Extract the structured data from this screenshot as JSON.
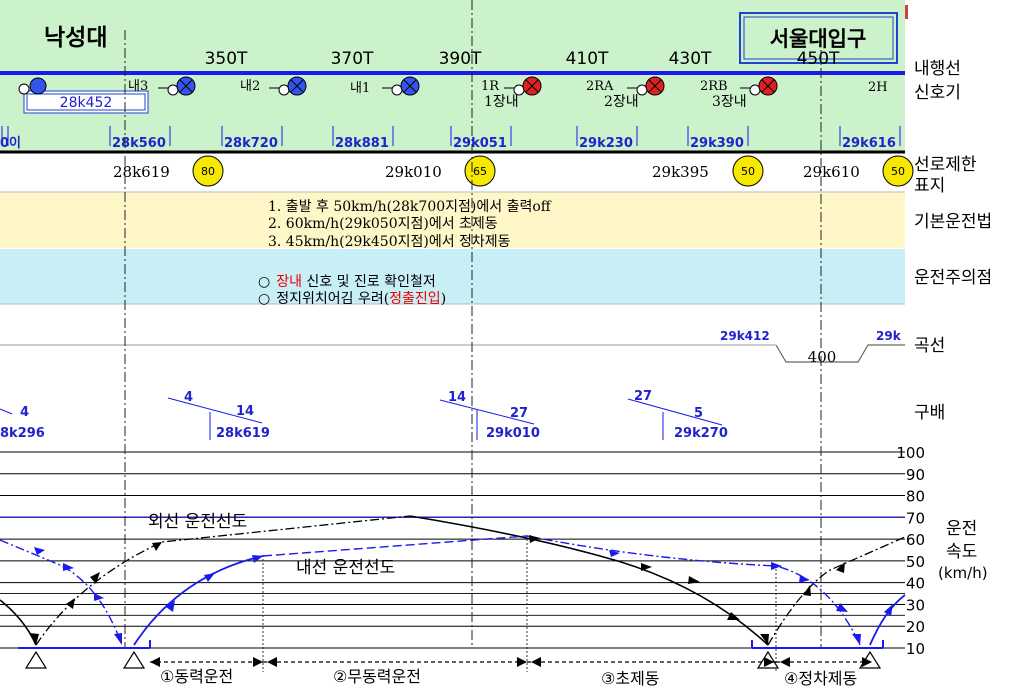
{
  "stations": {
    "left": "낙성대",
    "right": "서울대입구"
  },
  "track_circuits": [
    "350T",
    "370T",
    "390T",
    "410T",
    "430T",
    "450T"
  ],
  "signals": [
    {
      "label": "내3",
      "color": "#3355ee"
    },
    {
      "label": "내2",
      "color": "#3355ee"
    },
    {
      "label": "내1",
      "color": "#3355ee"
    },
    {
      "label": "1R",
      "sub": "1장내",
      "color": "#dd2222"
    },
    {
      "label": "2RA",
      "sub": "2장내",
      "color": "#dd2222"
    },
    {
      "label": "2RB",
      "sub": "3장내",
      "color": "#dd2222"
    },
    {
      "label": "2H"
    }
  ],
  "station_box_km": "28k452",
  "km_posts": [
    "0이",
    "28k560",
    "28k720",
    "28k881",
    "29k051",
    "29k230",
    "29k390",
    "29k616"
  ],
  "speed_limits": [
    {
      "km": "28k619",
      "value": "80"
    },
    {
      "km": "29k010",
      "value": "65"
    },
    {
      "km": "29k395",
      "value": "50"
    },
    {
      "km": "29k610",
      "value": "50"
    }
  ],
  "basic_driving": [
    "1. 출발 후 50km/h(28k700지점)에서 출력off",
    "2. 60km/h(29k050지점)에서 초제동",
    "3. 45km/h(29k450지점)에서 정차제동"
  ],
  "caution": [
    {
      "bullet": "○",
      "red": "장내",
      "text": " 신호 및 진로 확인철저"
    },
    {
      "bullet": "○",
      "text": "정지위치어김 우려(",
      "red": "정출진입",
      "tail": ")"
    }
  ],
  "curve": {
    "start_km": "29k412",
    "radius": "400",
    "end_km": "29k"
  },
  "gradients": [
    {
      "a": "4",
      "km": "8k296"
    },
    {
      "a": "4",
      "b": "14",
      "km": "28k619"
    },
    {
      "a": "14",
      "b": "27",
      "km": "29k010"
    },
    {
      "a": "27",
      "b": "5",
      "km": "29k270"
    }
  ],
  "row_labels": {
    "signal": "내행선\n신호기",
    "speed_limit": "선로제한\n표지",
    "basic": "기본운전법",
    "caution": "운전주의점",
    "curve": "곡선",
    "gradient": "구배",
    "speed": "운전\n속도",
    "speed_unit": "(km/h)"
  },
  "speed_axis": {
    "ticks": [
      100,
      90,
      80,
      70,
      60,
      50,
      40,
      30,
      20,
      10
    ]
  },
  "curve_labels": {
    "outer": "외선 운전선도",
    "inner": "내선 운전선도"
  },
  "phases": [
    "①동력운전",
    "②무동력운전",
    "③초제동",
    "④정차제동"
  ],
  "colors": {
    "green_bg": "#ccf2cc",
    "yellow_bg": "#fff7c8",
    "cyan_bg": "#c8eef6",
    "line_blue": "#1a1aee",
    "limit_circle": "#f6e800"
  }
}
